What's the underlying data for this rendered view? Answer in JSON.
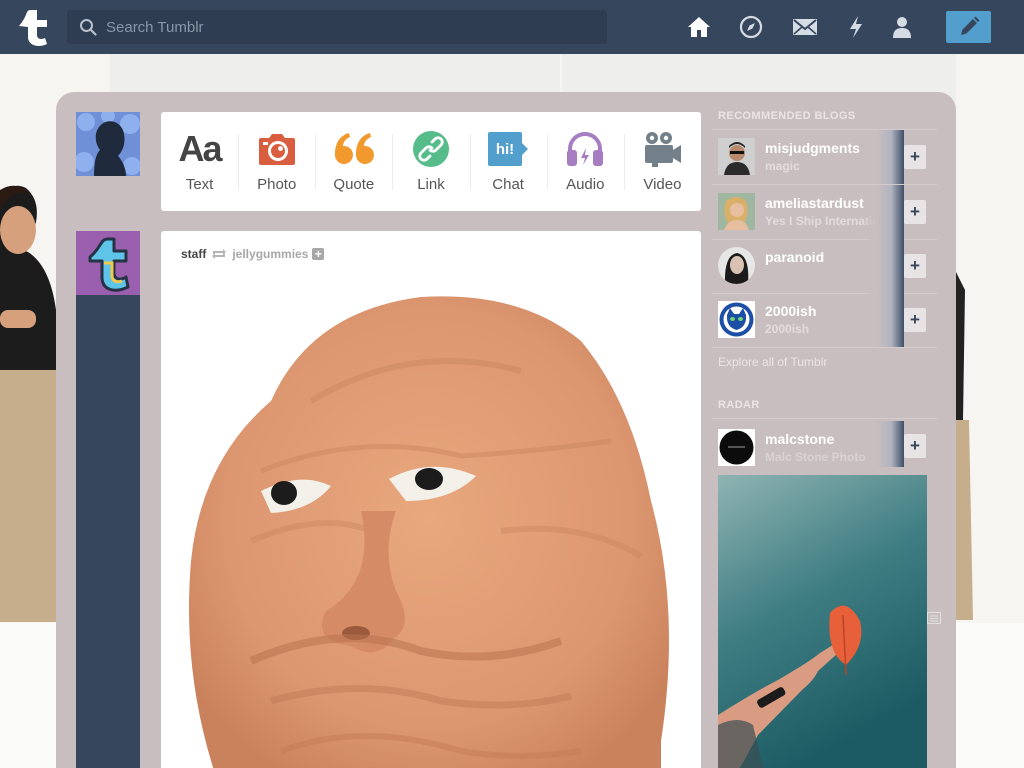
{
  "search": {
    "placeholder": "Search Tumblr"
  },
  "nav": {
    "items": [
      {
        "name": "dashboard",
        "icon": "home-icon"
      },
      {
        "name": "explore",
        "icon": "compass-icon"
      },
      {
        "name": "inbox",
        "icon": "envelope-icon"
      },
      {
        "name": "activity",
        "icon": "lightning-icon"
      },
      {
        "name": "account",
        "icon": "person-icon"
      }
    ],
    "compose_icon": "pencil-icon"
  },
  "post_types": [
    {
      "label": "Text",
      "glyph": "Aa",
      "icon": "text-icon",
      "color": "#444444"
    },
    {
      "label": "Photo",
      "icon": "camera-icon",
      "color": "#d95e40"
    },
    {
      "label": "Quote",
      "icon": "quote-icon",
      "color": "#f2992e"
    },
    {
      "label": "Link",
      "icon": "link-icon",
      "color": "#56bc8a"
    },
    {
      "label": "Chat",
      "glyph": "hi!",
      "icon": "chat-icon",
      "color": "#529ecc"
    },
    {
      "label": "Audio",
      "icon": "headphones-icon",
      "color": "#a77dc2"
    },
    {
      "label": "Video",
      "icon": "video-camera-icon",
      "color": "#748089"
    }
  ],
  "post": {
    "author": "staff",
    "source": "jellygummies",
    "follow_glyph": "+"
  },
  "sidebar": {
    "recommended_title": "RECOMMENDED BLOGS",
    "recommended": [
      {
        "name": "misjudgments",
        "subtitle": "magic"
      },
      {
        "name": "ameliastardust",
        "subtitle": "Yes I Ship Internationally"
      },
      {
        "name": "paranoid",
        "subtitle": ""
      },
      {
        "name": "2000ish",
        "subtitle": "2000ish"
      }
    ],
    "follow_glyph": "+",
    "explore_link": "Explore all of Tumblr",
    "radar_title": "RADAR",
    "radar": {
      "name": "malcstone",
      "subtitle": "Malc Stone Photo"
    }
  },
  "colors": {
    "topbar": "#36465d",
    "accent": "#529ecc",
    "dashboard_bg": "#c9bebf"
  }
}
